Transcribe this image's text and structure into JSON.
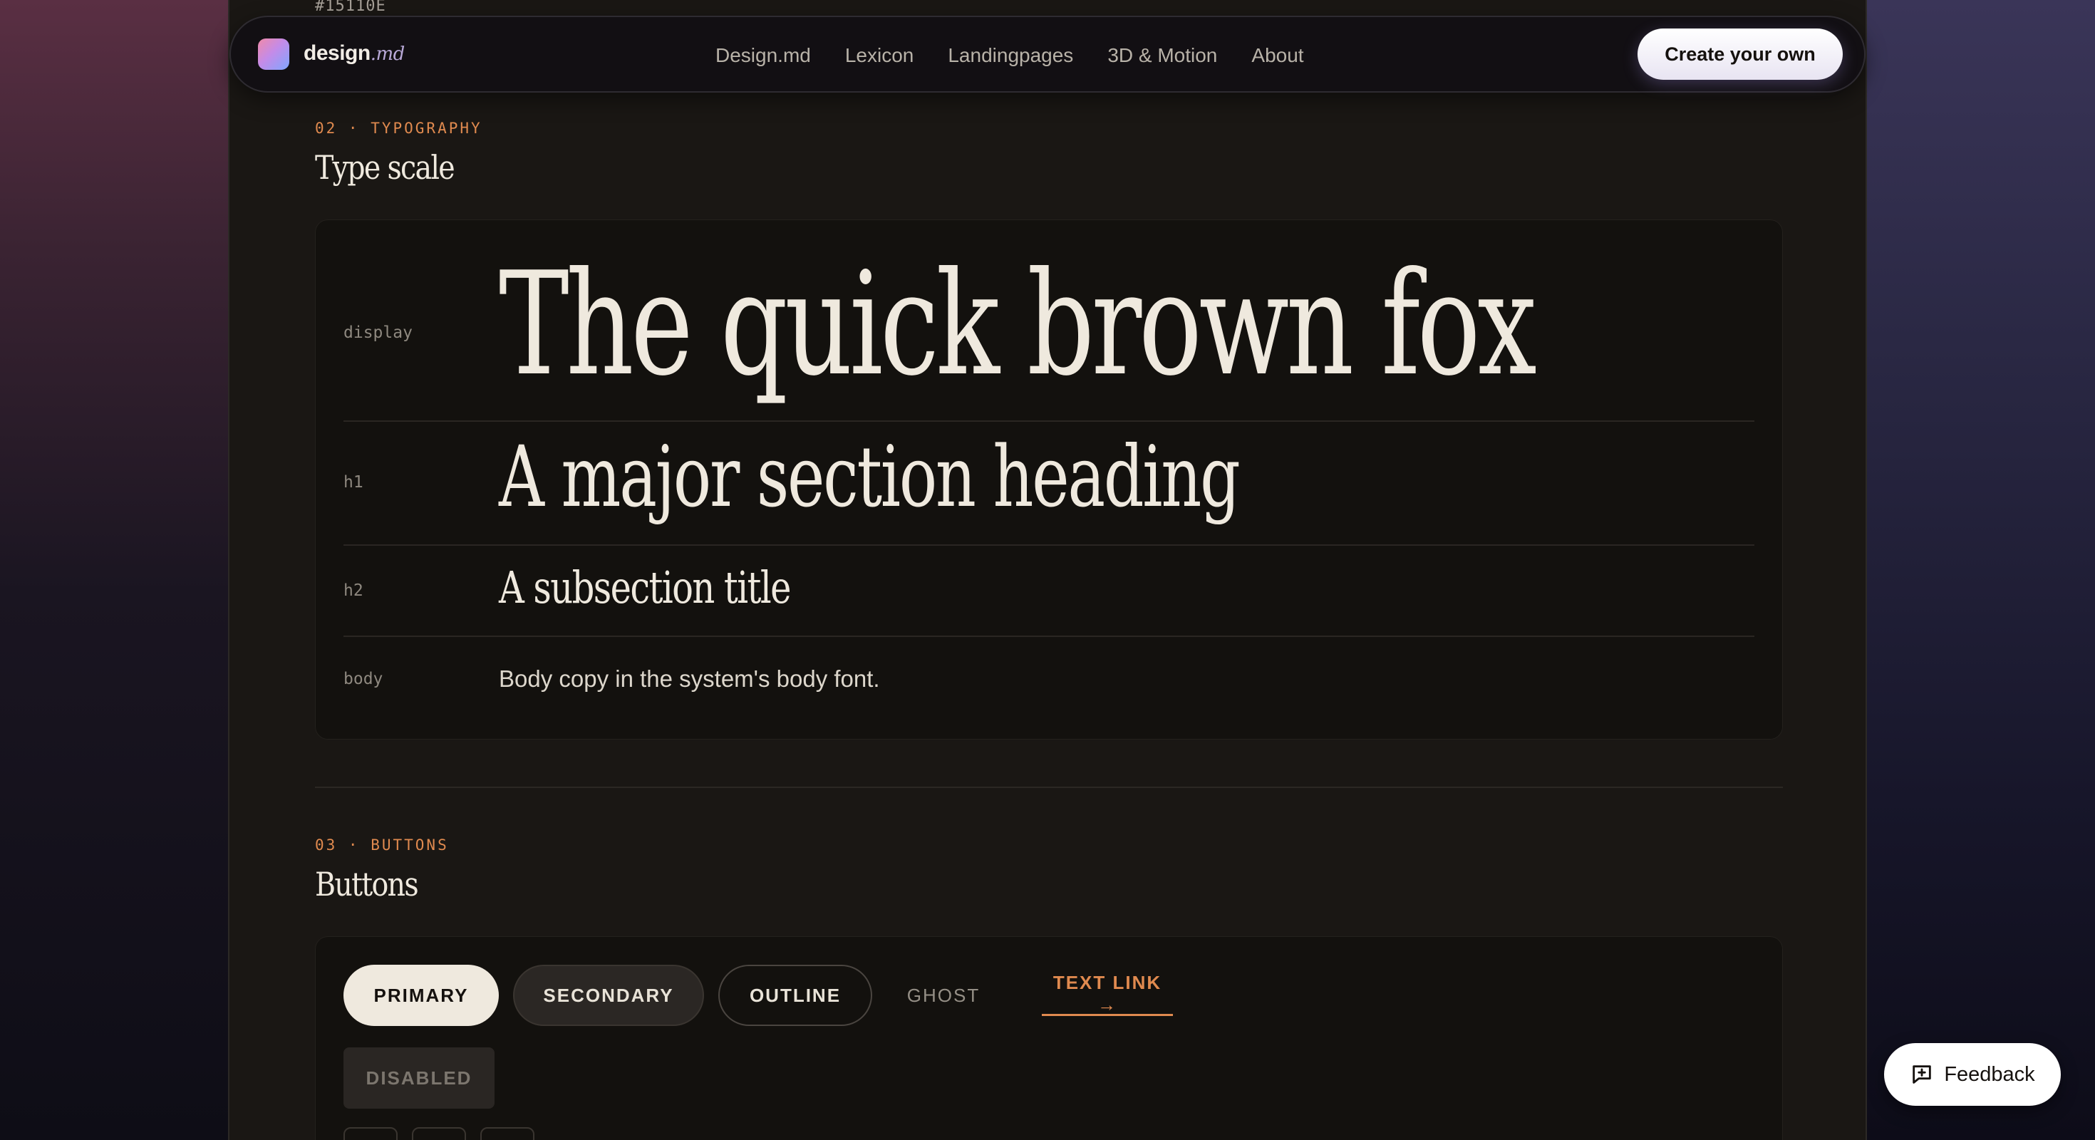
{
  "hex_code": "#15110E",
  "nav": {
    "brand": "design",
    "brand_suffix": ".md",
    "links": [
      "Design.md",
      "Lexicon",
      "Landingpages",
      "3D & Motion",
      "About"
    ],
    "cta_label": "Create your own"
  },
  "typography": {
    "eyebrow": "02 · TYPOGRAPHY",
    "title": "Type scale",
    "rows": [
      {
        "label": "display",
        "sample": "The quick brown fox"
      },
      {
        "label": "h1",
        "sample": "A major section heading"
      },
      {
        "label": "h2",
        "sample": "A subsection title"
      },
      {
        "label": "body",
        "sample": "Body copy in the system's body font."
      }
    ]
  },
  "buttons": {
    "eyebrow": "03 · BUTTONS",
    "title": "Buttons",
    "primary": "PRIMARY",
    "secondary": "SECONDARY",
    "outline": "OUTLINE",
    "ghost": "GHOST",
    "text_link": "TEXT LINK →",
    "disabled": "DISABLED"
  },
  "feedback_label": "Feedback",
  "colors": {
    "background": "#15110E",
    "accent": "#E08A4F",
    "text": "#EFE9DE"
  }
}
